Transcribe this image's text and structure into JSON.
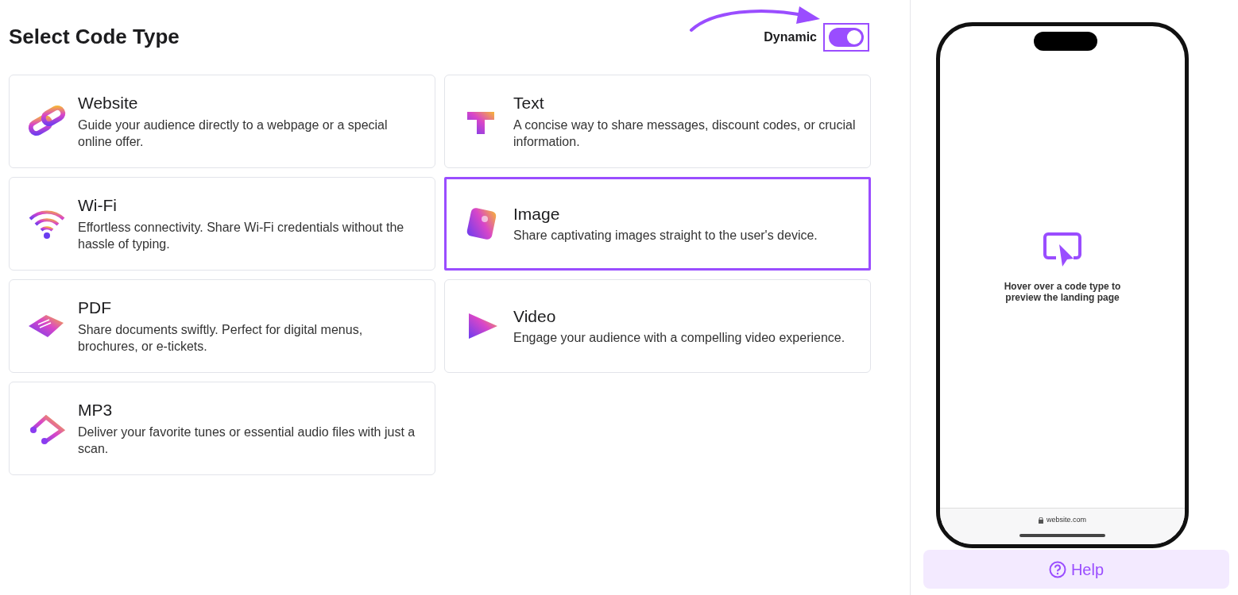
{
  "title": "Select Code Type",
  "dynamic_toggle": {
    "label": "Dynamic",
    "on": true
  },
  "code_types": [
    {
      "kind": "link",
      "title": "Website",
      "description": "Guide your audience directly to a webpage or a special online offer.",
      "selected": false
    },
    {
      "kind": "text",
      "title": "Text",
      "description": "A concise way to share messages, discount codes, or crucial information.",
      "selected": false
    },
    {
      "kind": "wifi",
      "title": "Wi-Fi",
      "description": "Effortless connectivity. Share Wi-Fi credentials without the hassle of typing.",
      "selected": false
    },
    {
      "kind": "image",
      "title": "Image",
      "description": "Share captivating images straight to the user's device.",
      "selected": true
    },
    {
      "kind": "pdf",
      "title": "PDF",
      "description": "Share documents swiftly. Perfect for digital menus, brochures, or e-tickets.",
      "selected": false
    },
    {
      "kind": "video",
      "title": "Video",
      "description": "Engage your audience with a compelling video experience.",
      "selected": false
    },
    {
      "kind": "mp3",
      "title": "MP3",
      "description": "Deliver your favorite tunes or essential audio files with just a scan.",
      "selected": false
    }
  ],
  "preview": {
    "message": "Hover over a code type to preview the landing page",
    "url": "website.com"
  },
  "help_button": "Help"
}
